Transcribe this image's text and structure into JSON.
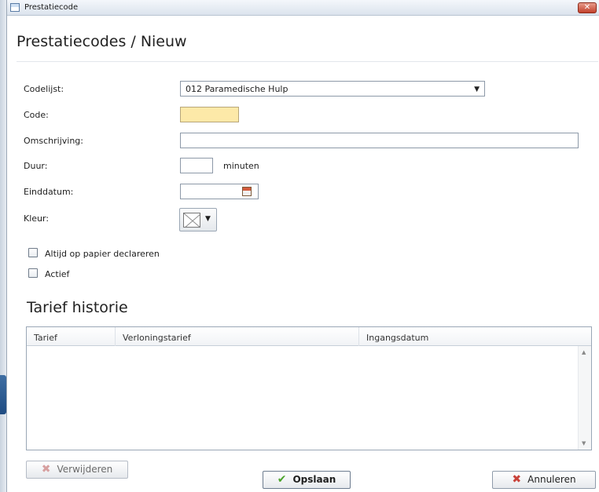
{
  "window": {
    "title": "Prestatiecode",
    "close_glyph": "✕"
  },
  "heading": "Prestatiecodes / Nieuw",
  "form": {
    "codelijst_label": "Codelijst:",
    "codelijst_value": "012 Paramedische Hulp",
    "code_label": "Code:",
    "code_value": "",
    "omschrijving_label": "Omschrijving:",
    "omschrijving_value": "",
    "duur_label": "Duur:",
    "duur_value": "",
    "duur_unit": "minuten",
    "einddatum_label": "Einddatum:",
    "einddatum_value": "",
    "kleur_label": "Kleur:",
    "papier_label": "Altijd op papier declareren",
    "papier_checked": false,
    "actief_label": "Actief",
    "actief_checked": false
  },
  "tarief": {
    "title": "Tarief historie",
    "columns": [
      "Tarief",
      "Verloningstarief",
      "Ingangsdatum"
    ],
    "rows": []
  },
  "buttons": {
    "verwijderen": "Verwijderen",
    "opslaan": "Opslaan",
    "annuleren": "Annuleren"
  },
  "icons": {
    "window": "app-window-icon",
    "calendar": "calendar-icon",
    "delete": "delete-x-icon",
    "save": "checkmark-icon",
    "cancel": "cancel-x-icon"
  },
  "colors": {
    "required_field": "#fde9a8",
    "save_check": "#4aa32a",
    "cancel_x": "#c9423a",
    "close_button": "#c2412b"
  }
}
